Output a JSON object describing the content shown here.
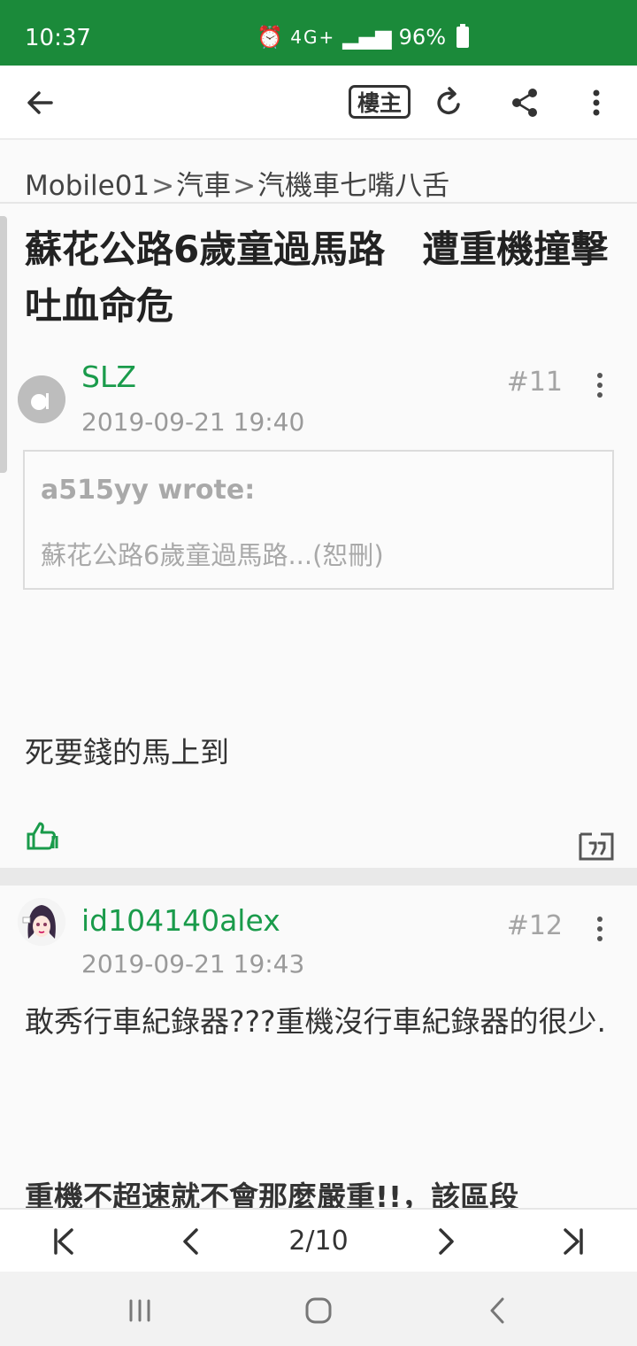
{
  "status_bar": {
    "time": "10:37",
    "network": "4G+",
    "battery": "96%"
  },
  "app_bar": {
    "op_label": "樓主"
  },
  "breadcrumb": {
    "items": [
      "Mobile01",
      "汽車",
      "汽機車七嘴八舌"
    ],
    "separator": ">"
  },
  "thread": {
    "title": "蘇花公路6歲童過馬路　遭重機撞擊吐血命危"
  },
  "posts": [
    {
      "author": "SLZ",
      "floor": "#11",
      "date": "2019-09-21 19:40",
      "quote": {
        "author": "a515yy wrote:",
        "text": "蘇花公路6歲童過馬路...(恕刪)"
      },
      "body": "死要錢的馬上到"
    },
    {
      "author": "id104140alex",
      "floor": "#12",
      "date": "2019-09-21 19:43",
      "body": "敢秀行車紀錄器???重機沒行車紀錄器的很少.",
      "body_partial": "重機不超速就不會那麼嚴重!!，該區段"
    }
  ],
  "pager": {
    "current": "2/10"
  },
  "colors": {
    "accent": "#1b8a3a",
    "author": "#1a9b4b"
  },
  "icons": [
    "back-arrow-icon",
    "refresh-icon",
    "share-icon",
    "more-vert-icon",
    "thumbs-up-icon",
    "quote-icon",
    "first-page-icon",
    "prev-page-icon",
    "next-page-icon",
    "last-page-icon",
    "recent-apps-icon",
    "home-icon",
    "system-back-icon"
  ]
}
